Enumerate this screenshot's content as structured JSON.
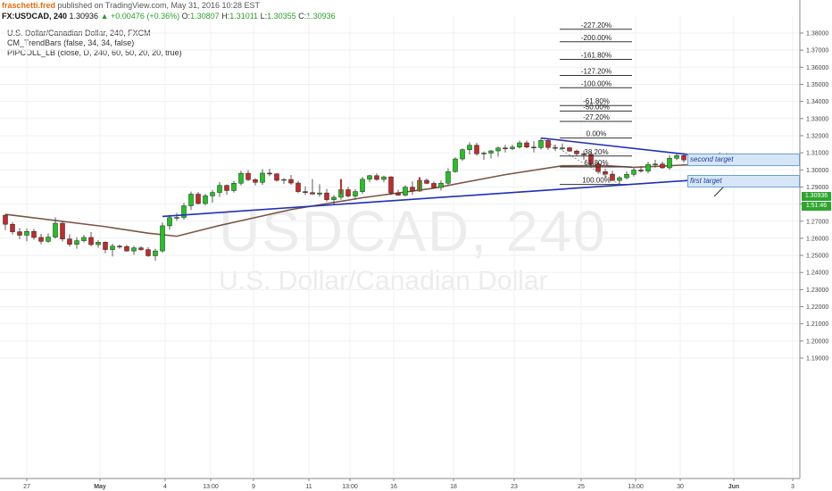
{
  "header": {
    "author": "fraschetti.fred",
    "published_text": "published on TradingView.com, May 31, 2016 10:28 EST",
    "symbol": "FX:USDCAD, 240",
    "last": "1.30936",
    "change": "+0.00476 (+0.36%)",
    "open_label": "O:",
    "open": "1.30807",
    "high_label": "H:",
    "high": "1.31011",
    "low_label": "L:",
    "low": "1.30355",
    "close_label": "C:",
    "close": "1.30936"
  },
  "legend": [
    "U.S. Dollar/Canadian Dollar, 240, FXCM",
    "CM_TrendBars (false, 34, 34, false)",
    "PIPCOLL_LB (close, D, 240, 60, 50, 20, 20, true)"
  ],
  "watermark": {
    "symbol": "USDCAD, 240",
    "name": "U.S. Dollar/Canadian Dollar"
  },
  "annotations": {
    "first_target": "first target",
    "second_target": "second target",
    "price_tag": "1.30936",
    "time_tag": "1:51:46"
  },
  "colors": {
    "up": "#22c322",
    "down": "#c42a2a",
    "ma": "#7b5544",
    "trendline": "#1f2fb8",
    "fib": "#333333",
    "target_box": "#d7e6f7"
  },
  "chart_data": {
    "type": "line",
    "series": [],
    "y_axis_labels": [
      "1.38000",
      "1.37000",
      "1.36000",
      "1.35000",
      "1.34000",
      "1.33000",
      "1.32000",
      "1.31000",
      "1.30000",
      "1.29000",
      "1.28000",
      "1.27000",
      "1.26000",
      "1.25000",
      "1.24000",
      "1.23000",
      "1.22000",
      "1.21000",
      "1.20000",
      "1.19000"
    ],
    "y_axis_values": [
      1.38,
      1.37,
      1.36,
      1.35,
      1.34,
      1.33,
      1.32,
      1.31,
      1.3,
      1.29,
      1.28,
      1.27,
      1.26,
      1.25,
      1.24,
      1.23,
      1.22,
      1.21,
      1.2,
      1.19
    ],
    "ylim": [
      1.1885,
      1.3855
    ],
    "x_axis_labels": [
      "27",
      "May",
      "4",
      "13:00",
      "9",
      "11",
      "13:00",
      "16",
      "18",
      "23",
      "25",
      "13:00",
      "30",
      "Jun",
      "3"
    ],
    "fib_levels": [
      "-227.20%",
      "-200.00%",
      "-161.80%",
      "-127.20%",
      "-100.00%",
      "-61.80%",
      "-50.00%",
      "-27.20%",
      "0.00%",
      "38.20%",
      "61.80%",
      "100.00%"
    ],
    "fib_prices": [
      1.3822,
      1.3749,
      1.3646,
      1.3552,
      1.348,
      1.3376,
      1.3344,
      1.3283,
      1.3186,
      1.3081,
      1.3017,
      1.2915
    ],
    "candles": [
      [
        1.2735,
        1.274,
        1.2648,
        1.2682
      ],
      [
        1.2682,
        1.2695,
        1.2622,
        1.2638
      ],
      [
        1.2638,
        1.266,
        1.2595,
        1.2618
      ],
      [
        1.2618,
        1.2658,
        1.2582,
        1.264
      ],
      [
        1.264,
        1.2655,
        1.2592,
        1.2605
      ],
      [
        1.2605,
        1.2626,
        1.2565,
        1.2582
      ],
      [
        1.2582,
        1.2628,
        1.2573,
        1.2607
      ],
      [
        1.2607,
        1.2722,
        1.2598,
        1.2688
      ],
      [
        1.2688,
        1.27,
        1.258,
        1.2596
      ],
      [
        1.2596,
        1.2624,
        1.2552,
        1.2565
      ],
      [
        1.2565,
        1.2606,
        1.2539,
        1.2586
      ],
      [
        1.2586,
        1.262,
        1.2576,
        1.2605
      ],
      [
        1.2605,
        1.2636,
        1.2553,
        1.2563
      ],
      [
        1.2563,
        1.259,
        1.2545,
        1.2577
      ],
      [
        1.2577,
        1.2582,
        1.2512,
        1.2534
      ],
      [
        1.2534,
        1.2568,
        1.2494,
        1.2554
      ],
      [
        1.2554,
        1.2564,
        1.2538,
        1.2552
      ],
      [
        1.2552,
        1.2561,
        1.2522,
        1.2526
      ],
      [
        1.2526,
        1.2556,
        1.2503,
        1.2544
      ],
      [
        1.2544,
        1.2553,
        1.2526,
        1.2534
      ],
      [
        1.2534,
        1.2549,
        1.2491,
        1.2498
      ],
      [
        1.2498,
        1.2539,
        1.247,
        1.2526
      ],
      [
        1.2526,
        1.2692,
        1.2517,
        1.2673
      ],
      [
        1.2673,
        1.2737,
        1.265,
        1.2721
      ],
      [
        1.2721,
        1.2748,
        1.2702,
        1.2722
      ],
      [
        1.2722,
        1.2808,
        1.2709,
        1.279
      ],
      [
        1.279,
        1.2873,
        1.2765,
        1.2858
      ],
      [
        1.2858,
        1.2871,
        1.2797,
        1.2803
      ],
      [
        1.2803,
        1.2861,
        1.2792,
        1.2848
      ],
      [
        1.2848,
        1.2883,
        1.2808,
        1.2868
      ],
      [
        1.2868,
        1.2929,
        1.2842,
        1.2909
      ],
      [
        1.2909,
        1.2915,
        1.2854,
        1.2879
      ],
      [
        1.2879,
        1.2936,
        1.2867,
        1.2922
      ],
      [
        1.2922,
        1.2995,
        1.2908,
        1.298
      ],
      [
        1.298,
        1.2999,
        1.2934,
        1.2943
      ],
      [
        1.2943,
        1.2951,
        1.2909,
        1.2927
      ],
      [
        1.2927,
        1.3004,
        1.2913,
        1.2981
      ],
      [
        1.2981,
        1.3007,
        1.2963,
        1.2977
      ],
      [
        1.2977,
        1.298,
        1.2931,
        1.2939
      ],
      [
        1.2939,
        1.295,
        1.2917,
        1.2944
      ],
      [
        1.2944,
        1.297,
        1.2913,
        1.2923
      ],
      [
        1.2923,
        1.2936,
        1.2864,
        1.2873
      ],
      [
        1.2873,
        1.2903,
        1.2853,
        1.2867
      ],
      [
        1.2867,
        1.2946,
        1.2859,
        1.2858
      ],
      [
        1.2858,
        1.2916,
        1.2843,
        1.2865
      ],
      [
        1.2865,
        1.2889,
        1.2814,
        1.2826
      ],
      [
        1.2826,
        1.2853,
        1.2796,
        1.284
      ],
      [
        1.284,
        1.2896,
        1.2825,
        1.2884
      ],
      [
        1.2884,
        1.2901,
        1.2838,
        1.2847
      ],
      [
        1.2847,
        1.2887,
        1.2826,
        1.2873
      ],
      [
        1.2873,
        1.2959,
        1.2859,
        1.2945
      ],
      [
        1.2945,
        1.2971,
        1.2928,
        1.2966
      ],
      [
        1.2966,
        1.298,
        1.2936,
        1.2944
      ],
      [
        1.2944,
        1.2966,
        1.2927,
        1.2959
      ],
      [
        1.2959,
        1.2963,
        1.2853,
        1.2865
      ],
      [
        1.2865,
        1.2885,
        1.2849,
        1.2852
      ],
      [
        1.2852,
        1.291,
        1.2846,
        1.2899
      ],
      [
        1.2899,
        1.2933,
        1.2854,
        1.2876
      ],
      [
        1.2876,
        1.2957,
        1.2872,
        1.2939
      ],
      [
        1.2939,
        1.2949,
        1.2917,
        1.2921
      ],
      [
        1.2921,
        1.2932,
        1.2896,
        1.2897
      ],
      [
        1.2897,
        1.2938,
        1.2879,
        1.2922
      ],
      [
        1.2922,
        1.3009,
        1.2913,
        1.299
      ],
      [
        1.299,
        1.3074,
        1.2984,
        1.3064
      ],
      [
        1.3064,
        1.3126,
        1.3053,
        1.3118
      ],
      [
        1.3118,
        1.3161,
        1.3089,
        1.3144
      ],
      [
        1.3144,
        1.3158,
        1.3083,
        1.3094
      ],
      [
        1.3094,
        1.3108,
        1.3059,
        1.3098
      ],
      [
        1.3098,
        1.3117,
        1.3066,
        1.3111
      ],
      [
        1.3111,
        1.3136,
        1.3077,
        1.3128
      ],
      [
        1.3128,
        1.3147,
        1.3102,
        1.3124
      ],
      [
        1.3124,
        1.3147,
        1.3115,
        1.3133
      ],
      [
        1.3133,
        1.3171,
        1.3124,
        1.3158
      ],
      [
        1.3158,
        1.3171,
        1.3127,
        1.3133
      ],
      [
        1.3133,
        1.3168,
        1.3102,
        1.313
      ],
      [
        1.313,
        1.3186,
        1.3119,
        1.3172
      ],
      [
        1.3172,
        1.3182,
        1.3117,
        1.3131
      ],
      [
        1.3131,
        1.3148,
        1.311,
        1.3129
      ],
      [
        1.3129,
        1.3154,
        1.3115,
        1.3129
      ],
      [
        1.3129,
        1.3135,
        1.3106,
        1.311
      ],
      [
        1.311,
        1.3119,
        1.3085,
        1.3094
      ],
      [
        1.3094,
        1.3113,
        1.306,
        1.309
      ],
      [
        1.309,
        1.3105,
        1.3023,
        1.3034
      ],
      [
        1.3034,
        1.3045,
        1.2977,
        1.299
      ],
      [
        1.299,
        1.3006,
        1.2953,
        1.2975
      ],
      [
        1.2975,
        1.2994,
        1.2934,
        1.2938
      ],
      [
        1.2938,
        1.2964,
        1.2915,
        1.2954
      ],
      [
        1.2954,
        1.2992,
        1.2944,
        1.2974
      ],
      [
        1.2974,
        1.3011,
        1.2961,
        1.2999
      ],
      [
        1.2999,
        1.3021,
        1.2983,
        1.2993
      ],
      [
        1.2993,
        1.3048,
        1.2979,
        1.3032
      ],
      [
        1.3032,
        1.3059,
        1.3013,
        1.3034
      ],
      [
        1.3034,
        1.3049,
        1.3007,
        1.3012
      ],
      [
        1.3012,
        1.3086,
        1.3001,
        1.3068
      ],
      [
        1.3068,
        1.3098,
        1.3056,
        1.3084
      ],
      [
        1.3084,
        1.3098,
        1.3042,
        1.3058
      ],
      [
        1.3058,
        1.3073,
        1.3035,
        1.3042
      ],
      [
        1.3042,
        1.3056,
        1.3025,
        1.3052
      ],
      [
        1.3052,
        1.306,
        1.3031,
        1.3037
      ],
      [
        1.3037,
        1.3091,
        1.3029,
        1.3079
      ],
      [
        1.3079,
        1.3101,
        1.3036,
        1.3052
      ],
      [
        1.3052,
        1.3098,
        1.3043,
        1.3094
      ]
    ],
    "moving_average": [
      [
        0,
        1.274
      ],
      [
        14,
        1.2668
      ],
      [
        20,
        1.263
      ],
      [
        24,
        1.2612
      ],
      [
        30,
        1.2675
      ],
      [
        40,
        1.2768
      ],
      [
        50,
        1.2837
      ],
      [
        60,
        1.2893
      ],
      [
        70,
        1.2972
      ],
      [
        78,
        1.3024
      ],
      [
        84,
        1.3025
      ],
      [
        88,
        1.3015
      ],
      [
        92,
        1.3022
      ],
      [
        101,
        1.3041
      ]
    ],
    "trendlines": [
      {
        "name": "upper",
        "points": [
          [
            75,
            1.3186
          ],
          [
            101,
            1.3062
          ]
        ]
      },
      {
        "name": "lower-support",
        "points": [
          [
            22,
            1.2728
          ],
          [
            101,
            1.2955
          ]
        ]
      }
    ]
  }
}
